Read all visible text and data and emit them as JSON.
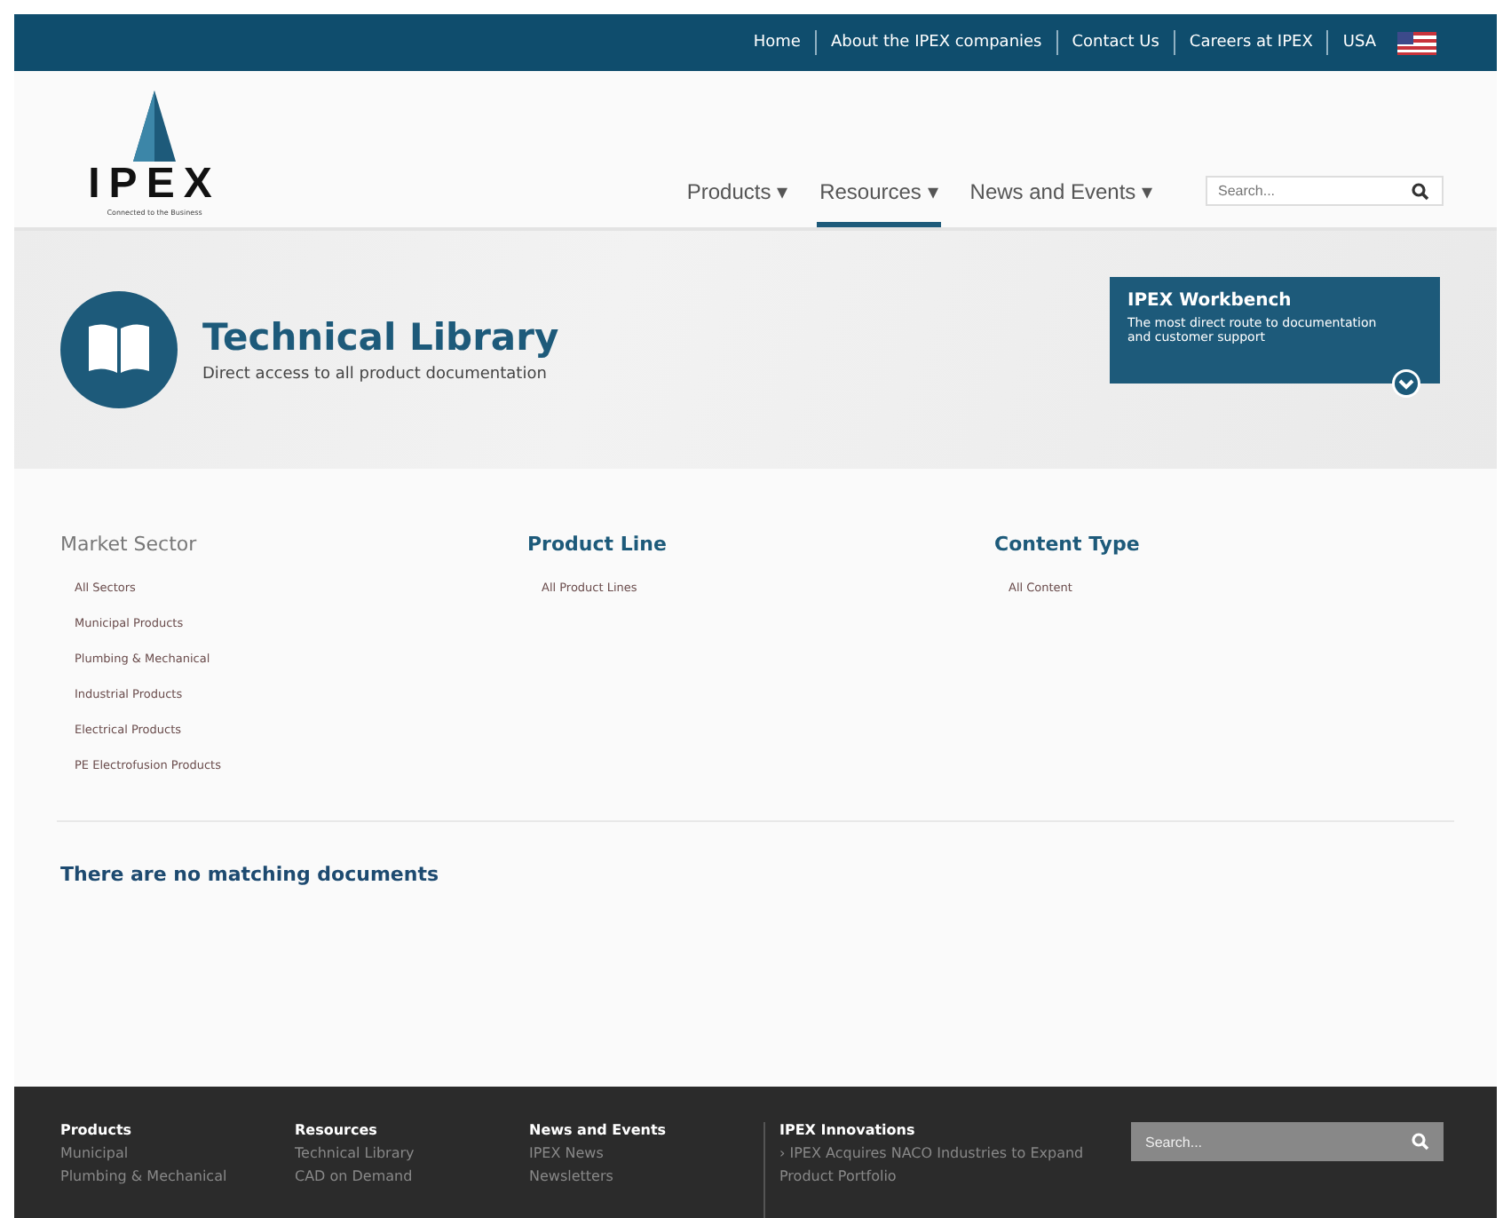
{
  "top_links": [
    "Home",
    "About the IPEX companies",
    "Contact Us",
    "Careers at IPEX",
    "USA"
  ],
  "logo": {
    "name": "IPEX",
    "tagline": "Connected to the Business"
  },
  "nav": [
    {
      "label": "Products ▾",
      "selected": false
    },
    {
      "label": "Resources ▾",
      "selected": true
    },
    {
      "label": "News and Events ▾",
      "selected": false
    }
  ],
  "search": {
    "placeholder": "Search..."
  },
  "banner": {
    "title": "Technical Library",
    "subtitle": "Direct access to all product documentation"
  },
  "workbench": {
    "title": "IPEX Workbench",
    "text": "The most direct route to documentation and customer support"
  },
  "filters": [
    {
      "heading": "Market Sector",
      "dimmed": true,
      "items": [
        "All Sectors",
        "Municipal Products",
        "Plumbing & Mechanical",
        "Industrial Products",
        "Electrical Products",
        "PE Electrofusion Products"
      ]
    },
    {
      "heading": "Product Line",
      "dimmed": false,
      "items": [
        "All Product Lines"
      ]
    },
    {
      "heading": "Content Type",
      "dimmed": false,
      "items": [
        "All Content"
      ]
    }
  ],
  "no_results": "There are no matching documents",
  "footer": {
    "columns": [
      {
        "heading": "Products",
        "links": [
          "Municipal",
          "Plumbing & Mechanical"
        ]
      },
      {
        "heading": "Resources",
        "links": [
          "Technical Library",
          "CAD on Demand"
        ]
      },
      {
        "heading": "News and Events",
        "links": [
          "IPEX News",
          "Newsletters"
        ]
      },
      {
        "heading": "IPEX Innovations",
        "links": [
          "› IPEX Acquires NACO Industries to Expand Product Portfolio"
        ]
      }
    ],
    "search": {
      "placeholder": "Search..."
    }
  }
}
